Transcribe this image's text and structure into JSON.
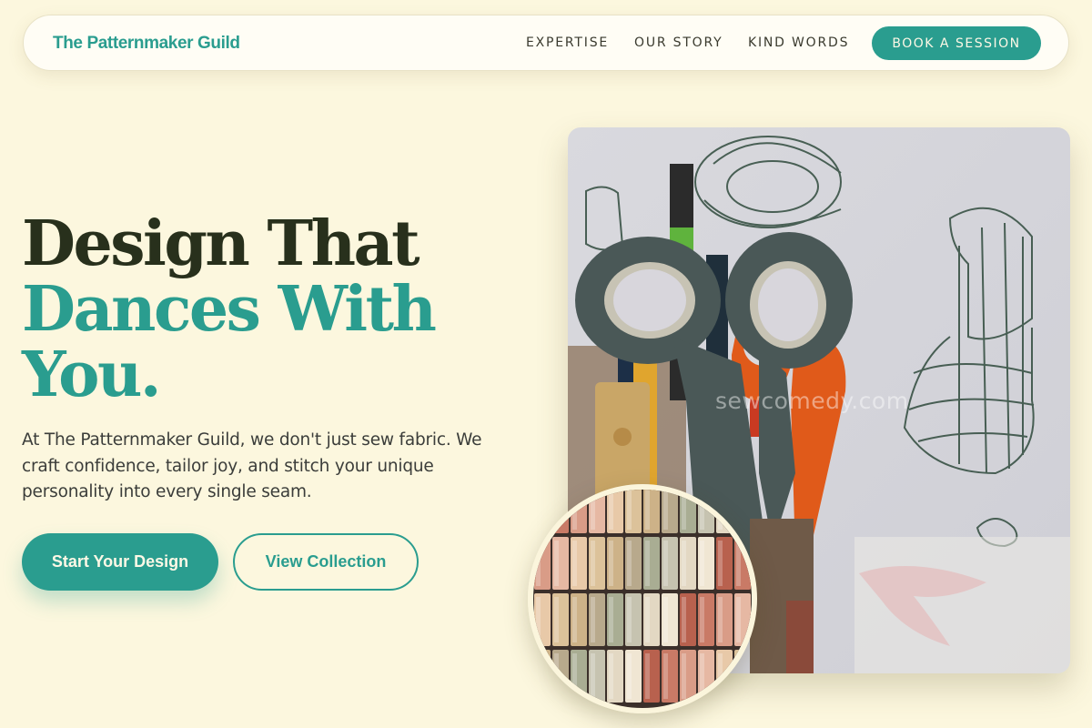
{
  "nav": {
    "brand": "The Patternmaker Guild",
    "links": [
      "EXPERTISE",
      "OUR STORY",
      "KIND WORDS"
    ],
    "cta": "BOOK A SESSION"
  },
  "hero": {
    "headline_line1": "Design That",
    "headline_line2": "Dances With",
    "headline_line3": "You.",
    "lede": "At The Patternmaker Guild, we don't just sew fabric. We craft confidence, tailor joy, and stitch your unique personality into every single seam.",
    "primary_cta": "Start Your Design",
    "secondary_cta": "View Collection"
  },
  "media": {
    "main_image": "scissors-and-pencils-photo",
    "watermark": "sewcomedy.com",
    "inset_image": "fabric-swatches-photo"
  },
  "colors": {
    "background": "#fcf7de",
    "accent": "#2a9d8f",
    "heading_dark": "#28301c"
  }
}
